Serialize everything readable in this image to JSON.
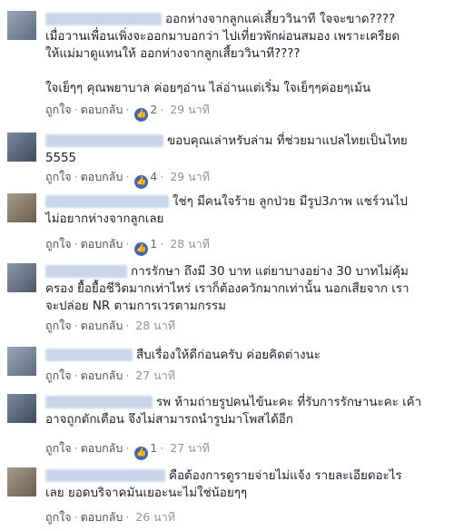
{
  "comments": [
    {
      "lines": [
        "ออกห่างจากลูกแค่เสี้ยววินาที ใจจะขาด????",
        "เมื่อวานเพื่อนเพิ่งจะออกมาบอกว่า ไปเที่ยวพักผ่อนสมอง เพราะเครียด",
        "ให้แม่มาดูแทนให้ ออกห่างจากลูกเสี้ยววินาที????",
        "",
        "ใจเย็ๆๆ คุณพยาบาล ค่อยๆอ่าน ไล่อ่านแต่เริ่ม ใจเย็ๆๆค่อยๆเม้น"
      ],
      "like": "ถูกใจ",
      "reply": "ตอบกลับ",
      "reactions": "2",
      "time": "29 นาที"
    },
    {
      "lines": [
        "ขอบคุณเล่าหรับล่าม ที่ช่วยมาแปลไทยเป็นไทย",
        "5555"
      ],
      "like": "ถูกใจ",
      "reply": "ตอบกลับ",
      "reactions": "4",
      "time": "29 นาที"
    },
    {
      "lines": [
        "ใช่ๆ มีคนใจร้าย ลูกป่วย มีรูป3ภาพ แชร์วนไป",
        "ไม่อยากห่างจากลูกเลย"
      ],
      "like": "ถูกใจ",
      "reply": "ตอบกลับ",
      "reactions": "1",
      "time": "28 นาที"
    },
    {
      "lines": [
        "การรักษา ถึงมี 30 บาท แต่ยาบางอย่าง 30 บาทไม่คุ้ม",
        "ครอง ยื้อยื้อชีวิตมากเท่าไหร่ เราก็ต้องควักมากเท่านั้น นอกเสียจาก เรา",
        "จะปล่อย NR ตามการเวรตามกรรม"
      ],
      "like": "ถูกใจ",
      "reply": "ตอบกลับ",
      "reactions": "",
      "time": "28 นาที"
    },
    {
      "lines": [
        "สืบเรื่องให้ดีก่อนครับ ค่อยคิดต่างนะ"
      ],
      "like": "ถูกใจ",
      "reply": "ตอบกลับ",
      "reactions": "",
      "time": "27 นาที"
    },
    {
      "lines": [
        "รพ ห้ามถ่ายรูปคนไข้นะคะ ที่รับการรักษานะคะ เค้า",
        "อาจถูกตักเตือน จึงไม่สามารถนำรูปมาโพสได้อีก"
      ],
      "like": "ถูกใจ",
      "reply": "ตอบกลับ",
      "reactions": "1",
      "time": "27 นาที"
    },
    {
      "lines": [
        "คือต้องการดูรายจ่ายไม่แจ้ง รายละเอียดอะไร",
        "เลย ยอดบริจาคมันเยอะนะไม่ใช่น้อยๆๆ"
      ],
      "like": "ถูกใจ",
      "reply": "ตอบกลับ",
      "reactions": "",
      "time": "26 นาที"
    }
  ],
  "colors": {
    "link": "#4267b2",
    "meta": "#90949c",
    "text": "#1d2129"
  }
}
